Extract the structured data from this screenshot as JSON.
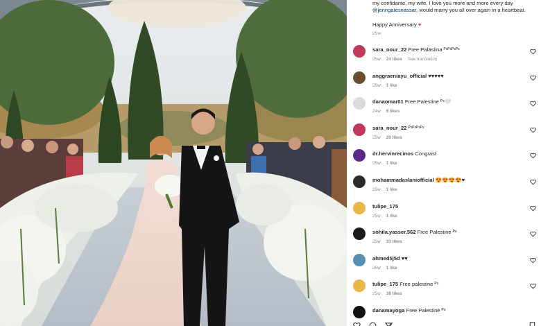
{
  "caption": {
    "line1": "my confidante, my wife. I love you more and more every day",
    "mention": "@jenngatesnassar",
    "line2_rest": ", would marry you all over again in a heartbeat.",
    "anniversary": "Happy Anniversary",
    "heart": "♥",
    "age": "25w"
  },
  "comments": [
    {
      "user": "sara_nour_22",
      "text": "Free Palästina ᴾˢᴾˢᴾˢᴾˢ",
      "age": "25w",
      "likes": "24 likes",
      "extra": "See translation",
      "avatar_color": "#c0395b"
    },
    {
      "user": "anggraeniayu_official",
      "text": "♥♥♥♥♥",
      "age": "25w",
      "likes": "1 like",
      "extra": "",
      "avatar_color": "#6b4d32"
    },
    {
      "user": "danaomar01",
      "text": "Free Palestine ᴾˢ🤍",
      "age": "24w",
      "likes": "6 likes",
      "extra": "",
      "avatar_color": "#dbdbdb"
    },
    {
      "user": "sara_nour_22",
      "text": "ᴾˢᴾˢᴾˢᴾˢ",
      "age": "25w",
      "likes": "20 likes",
      "extra": "",
      "avatar_color": "#c0395b"
    },
    {
      "user": "dr.hervinrecinos",
      "text": "Congrast",
      "age": "25w",
      "likes": "1 like",
      "extra": "",
      "avatar_color": "#5b2b8c"
    },
    {
      "user": "mohammadaslaniofficial",
      "text": "😍😍😍😍♥",
      "age": "25w",
      "likes": "1 like",
      "extra": "",
      "avatar_color": "#2a2a2a"
    },
    {
      "user": "tulipe_175",
      "text": "",
      "age": "25w",
      "likes": "1 like",
      "extra": "",
      "avatar_color": "#e9b648"
    },
    {
      "user": "sohila.yasser.562",
      "text": "Free Palestine ᴾˢ",
      "age": "25w",
      "likes": "33 likes",
      "extra": "",
      "avatar_color": "#1a1a1a"
    },
    {
      "user": "ahmed5j5d",
      "text": "♥♥",
      "age": "25w",
      "likes": "1 like",
      "extra": "",
      "avatar_color": "#5a8fb5"
    },
    {
      "user": "tulipe_175",
      "text": "Free palestine ᴾˢ",
      "age": "25w",
      "likes": "38 likes",
      "extra": "",
      "avatar_color": "#e9b648"
    },
    {
      "user": "danamayoga",
      "text": "Free Palestine ᴾˢ",
      "age": "",
      "likes": "",
      "extra": "",
      "avatar_color": "#111111"
    }
  ],
  "colors": {
    "like_red": "#ed4956",
    "mention_blue": "#00376b",
    "meta_grey": "#8e8e8e"
  },
  "icons": [
    "heart-outline-icon",
    "comment-icon",
    "share-icon",
    "bookmark-icon"
  ]
}
